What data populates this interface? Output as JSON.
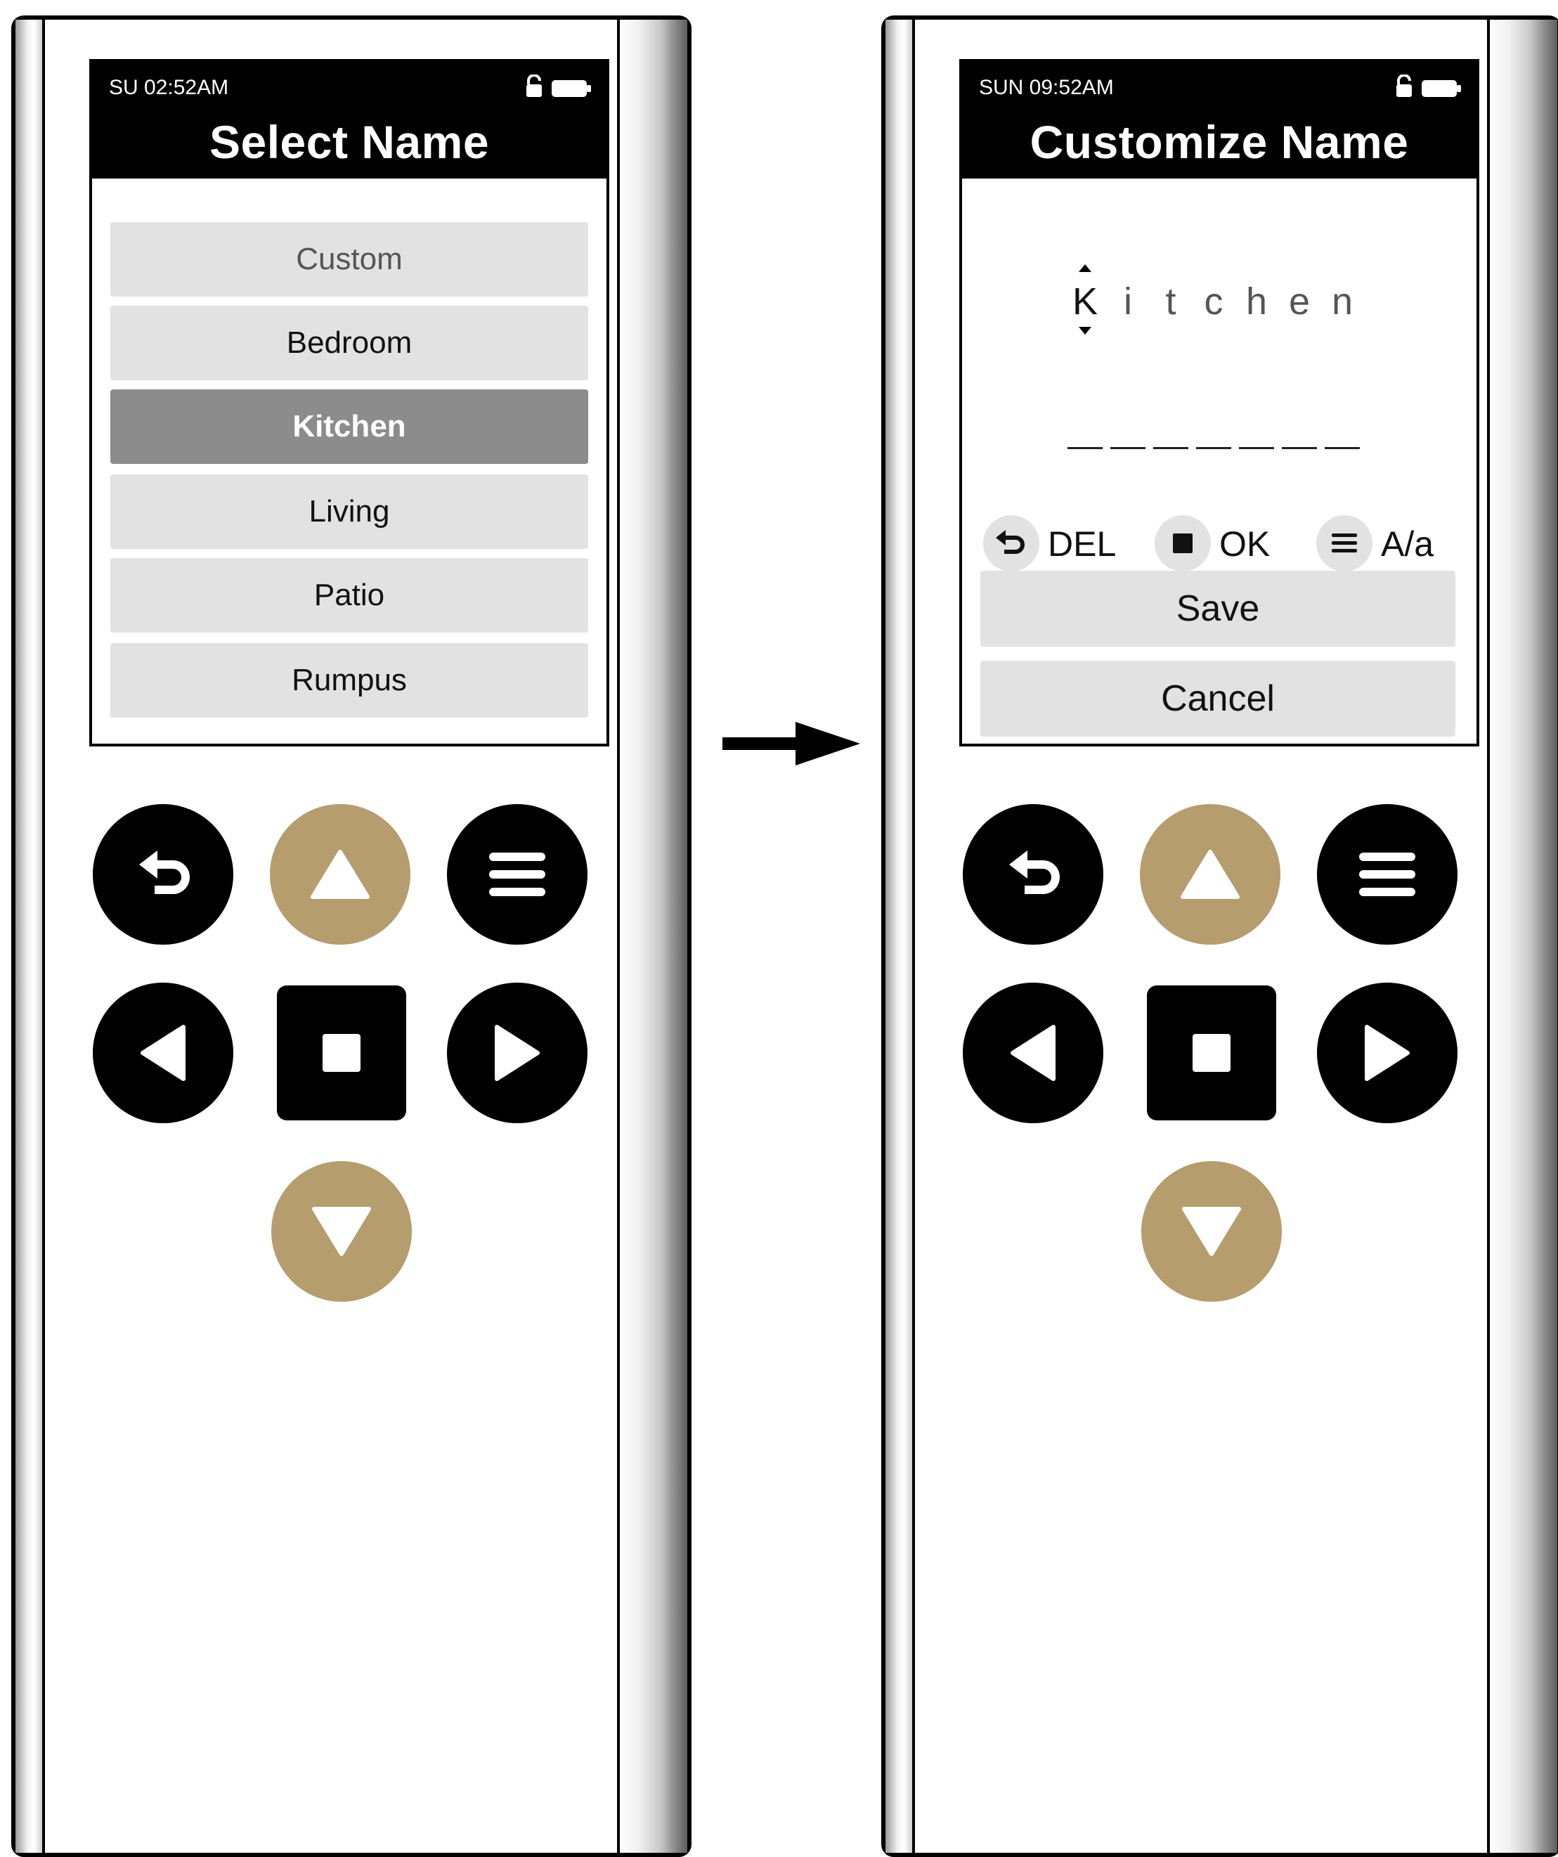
{
  "left_screen": {
    "status_time": "SU 02:52AM",
    "title": "Select Name",
    "items": [
      "Custom",
      "Bedroom",
      "Kitchen",
      "Living",
      "Patio",
      "Rumpus"
    ],
    "selected_item": "Kitchen"
  },
  "right_screen": {
    "status_time": "SUN 09:52AM",
    "title": "Customize Name",
    "name_chars": [
      "K",
      "i",
      "t",
      "c",
      "h",
      "e",
      "n"
    ],
    "hints": [
      {
        "icon": "back-icon",
        "label": "DEL"
      },
      {
        "icon": "stop-icon",
        "label": "OK"
      },
      {
        "icon": "menu-icon",
        "label": "A/a"
      }
    ],
    "save_label": "Save",
    "cancel_label": "Cancel"
  },
  "status_icons": [
    "lock-open-icon",
    "battery-icon"
  ],
  "keypad": {
    "buttons": [
      "back-button",
      "up-button",
      "menu-button",
      "left-button",
      "ok-button",
      "right-button",
      "down-button"
    ]
  },
  "colors": {
    "gold": "#b59d6d",
    "black": "#000000",
    "list_bg": "#e2e2e2",
    "selected_bg": "#8c8c8c"
  }
}
